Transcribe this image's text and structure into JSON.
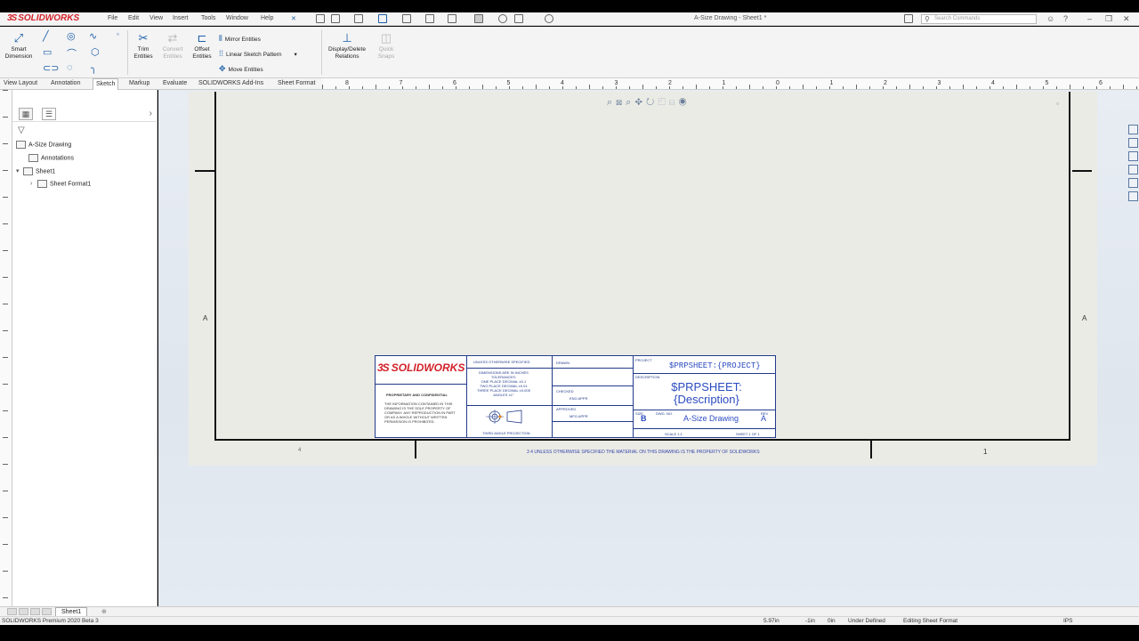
{
  "app": {
    "logo_ds": "3S",
    "logo_text": "SOLIDWORKS",
    "title": "A-Size Drawing - Sheet1 *",
    "search_placeholder": "Search Commands",
    "menus": [
      "File",
      "Edit",
      "View",
      "Insert",
      "Tools",
      "Window",
      "Help"
    ]
  },
  "ribbon": {
    "smart_dimension": "Smart\nDimension",
    "trim_entities": "Trim\nEntities",
    "convert_entities": "Convert\nEntities",
    "offset_entities": "Offset\nEntities",
    "mirror_entities": "Mirror Entities",
    "linear_pattern": "Linear Sketch Pattern",
    "move_entities": "Move Entities",
    "display_relations": "Display/Delete\nRelations",
    "quick_snaps": "Quick\nSnaps"
  },
  "tabs": [
    "View Layout",
    "Annotation",
    "Sketch",
    "Markup",
    "Evaluate",
    "SOLIDWORKS Add-Ins",
    "Sheet Format"
  ],
  "active_tab": "Sketch",
  "ruler_numbers": [
    "8",
    "7",
    "6",
    "5",
    "4",
    "3",
    "2",
    "1",
    "0",
    "1",
    "2",
    "3",
    "4",
    "5",
    "6",
    "7"
  ],
  "tree": {
    "root": "A-Size Drawing",
    "annotations": "Annotations",
    "sheet": "Sheet1",
    "sheet_format": "Sheet Format1"
  },
  "sheet": {
    "zone_left": "A",
    "zone_right": "A",
    "zone_bottom_left": "4",
    "zone_bottom_right": "1",
    "bottom_note": "3   4   UNLESS OTHERWISE SPECIFIED THE MATERIAL ON THIS DRAWING IS THE PROPERTY OF SOLIDWORKS"
  },
  "title_block": {
    "logo_ds": "3S",
    "logo_text": "SOLIDWORKS",
    "proprietary_title": "PROPRIETARY AND CONFIDENTIAL",
    "proprietary_body": "THE INFORMATION CONTAINED IN THIS DRAWING IS THE SOLE PROPERTY OF COMPANY. ANY REPRODUCTION IN PART OR AS A WHOLE WITHOUT WRITTEN PERMISSION IS PROHIBITED.",
    "dims_title": "UNLESS OTHERWISE SPECIFIED",
    "dims_body": "DIMENSIONS ARE IN INCHES\nTOLERANCES:\nONE PLACE DECIMAL ±0.1\nTWO PLACE DECIMAL ±0.01\nTHREE PLACE DECIMAL ±0.005\nANGLES ±1°",
    "projection": "THIRD ANGLE PROJECTION",
    "drawn": "DRAWN",
    "checked": "CHECKED",
    "approved": "APPROVED",
    "eng_appr": "ENG APPR",
    "mfg_appr": "MFG APPR",
    "project_label": "PROJECT",
    "project_value": "$PRPSHEET:{PROJECT}",
    "desc_label": "DESCRIPTION",
    "desc_value": "$PRPSHEET:{Description}",
    "size_label": "SIZE",
    "size_value": "B",
    "dwg_label": "DWG. NO.",
    "dwg_value": "A-Size Drawing",
    "rev_label": "REV",
    "rev_value": "A",
    "scale": "SCALE 1:1",
    "sheet_of": "SHEET 1 OF 1"
  },
  "sheet_tab": "Sheet1",
  "status": {
    "product": "SOLIDWORKS Premium 2020 Beta 3",
    "coords": "5.97in",
    "coords2": "-1in",
    "coords3": "0in",
    "defined": "Under Defined",
    "mode": "Editing Sheet Format",
    "units": "IPS"
  }
}
